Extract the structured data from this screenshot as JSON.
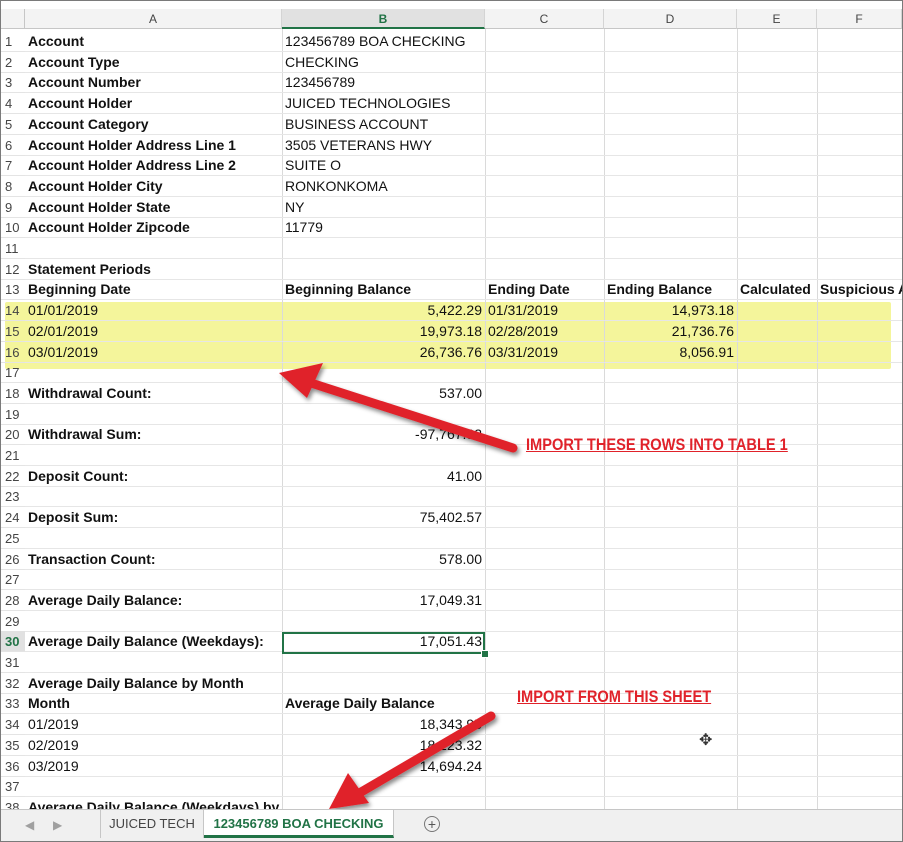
{
  "columns": [
    "A",
    "B",
    "C",
    "D",
    "E",
    "F"
  ],
  "selected_column": "B",
  "selected_row": "30",
  "rows": [
    {
      "n": "1",
      "a": "Account",
      "b": "123456789 BOA CHECKING",
      "a_bold": true
    },
    {
      "n": "2",
      "a": "Account Type",
      "b": "CHECKING",
      "a_bold": true
    },
    {
      "n": "3",
      "a": "Account Number",
      "b": "123456789",
      "a_bold": true
    },
    {
      "n": "4",
      "a": "Account Holder",
      "b": "JUICED TECHNOLOGIES",
      "a_bold": true
    },
    {
      "n": "5",
      "a": "Account Category",
      "b": "BUSINESS ACCOUNT",
      "a_bold": true
    },
    {
      "n": "6",
      "a": "Account Holder Address Line 1",
      "b": "3505 VETERANS HWY",
      "a_bold": true
    },
    {
      "n": "7",
      "a": "Account Holder Address Line 2",
      "b": "SUITE O",
      "a_bold": true
    },
    {
      "n": "8",
      "a": "Account Holder City",
      "b": "RONKONKOMA",
      "a_bold": true
    },
    {
      "n": "9",
      "a": "Account Holder State",
      "b": "NY",
      "a_bold": true
    },
    {
      "n": "10",
      "a": "Account Holder Zipcode",
      "b": "11779",
      "a_bold": true
    },
    {
      "n": "11"
    },
    {
      "n": "12",
      "a": "Statement Periods",
      "a_bold": true
    },
    {
      "n": "13",
      "a": "Beginning Date",
      "b": "Beginning Balance",
      "c": "Ending Date",
      "d": "Ending Balance",
      "e": "Calculated",
      "f": "Suspicious A",
      "header": true
    },
    {
      "n": "14",
      "a": "01/01/2019",
      "b": "5,422.29",
      "c": "01/31/2019",
      "d": "14,973.18",
      "b_num": true,
      "d_num": true
    },
    {
      "n": "15",
      "a": "02/01/2019",
      "b": "19,973.18",
      "c": "02/28/2019",
      "d": "21,736.76",
      "b_num": true,
      "d_num": true
    },
    {
      "n": "16",
      "a": "03/01/2019",
      "b": "26,736.76",
      "c": "03/31/2019",
      "d": "8,056.91",
      "b_num": true,
      "d_num": true
    },
    {
      "n": "17"
    },
    {
      "n": "18",
      "a": "Withdrawal Count:",
      "b": "537.00",
      "a_bold": true,
      "b_num": true
    },
    {
      "n": "19"
    },
    {
      "n": "20",
      "a": "Withdrawal Sum:",
      "b": "-97,767.32",
      "a_bold": true,
      "b_num": true
    },
    {
      "n": "21"
    },
    {
      "n": "22",
      "a": "Deposit Count:",
      "b": "41.00",
      "a_bold": true,
      "b_num": true
    },
    {
      "n": "23"
    },
    {
      "n": "24",
      "a": "Deposit Sum:",
      "b": "75,402.57",
      "a_bold": true,
      "b_num": true
    },
    {
      "n": "25"
    },
    {
      "n": "26",
      "a": "Transaction Count:",
      "b": "578.00",
      "a_bold": true,
      "b_num": true
    },
    {
      "n": "27"
    },
    {
      "n": "28",
      "a": "Average Daily Balance:",
      "b": "17,049.31",
      "a_bold": true,
      "b_num": true
    },
    {
      "n": "29"
    },
    {
      "n": "30",
      "a": "Average Daily Balance (Weekdays):",
      "b": "17,051.43",
      "a_bold": true,
      "b_num": true
    },
    {
      "n": "31"
    },
    {
      "n": "32",
      "a": "Average Daily Balance by Month",
      "a_bold": true
    },
    {
      "n": "33",
      "a": "Month",
      "b": "Average Daily Balance",
      "header": true
    },
    {
      "n": "34",
      "a": "01/2019",
      "b": "18,343.95",
      "b_num": true
    },
    {
      "n": "35",
      "a": "02/2019",
      "b": "18,223.32",
      "b_num": true
    },
    {
      "n": "36",
      "a": "03/2019",
      "b": "14,694.24",
      "b_num": true
    },
    {
      "n": "37"
    },
    {
      "n": "38",
      "a": "Average Daily Balance (Weekdays) by Month",
      "a_bold": true
    }
  ],
  "annotations": {
    "rows_note": "IMPORT THESE ROWS INTO TABLE 1",
    "sheet_note": "IMPORT FROM THIS SHEET",
    "color": "#e0222a"
  },
  "highlight_color": "#f2f38a",
  "sheet_tabs": [
    {
      "label": "JUICED TECH",
      "active": false
    },
    {
      "label": "123456789 BOA CHECKING",
      "active": true
    }
  ],
  "add_sheet_label": "+",
  "accent_color": "#217346"
}
